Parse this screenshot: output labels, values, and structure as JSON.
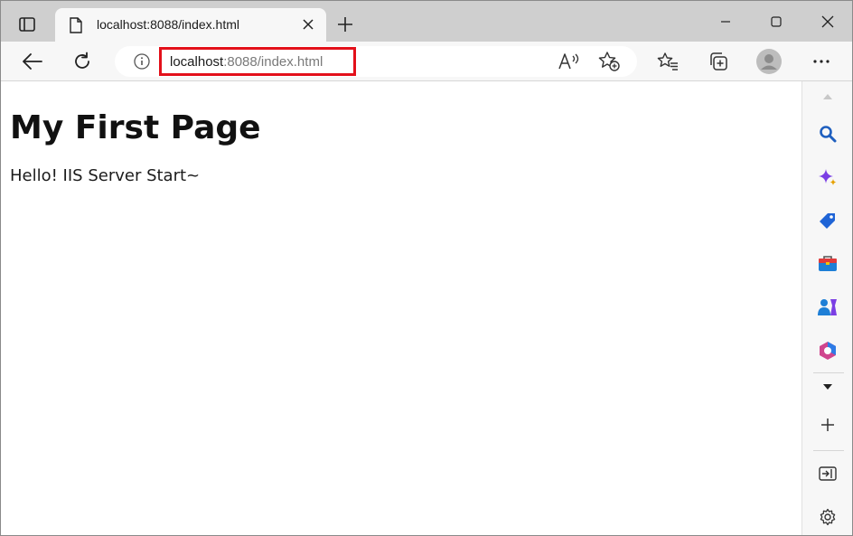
{
  "tab": {
    "title": "localhost:8088/index.html"
  },
  "address": {
    "host": "localhost",
    "rest": ":8088/index.html"
  },
  "page": {
    "heading": "My First Page",
    "paragraph": "Hello! IIS Server Start~"
  },
  "colors": {
    "highlight_border": "#e3101a",
    "tabstrip": "#cfcfcf",
    "toolbar": "#f7f7f7"
  },
  "sidebar": {
    "items": [
      "scroll-up-icon",
      "search-icon",
      "copilot-icon",
      "shopping-tag-icon",
      "tools-icon",
      "games-icon",
      "office-icon",
      "chevron-down-icon",
      "add-icon",
      "hide-sidebar-icon",
      "settings-icon"
    ]
  }
}
